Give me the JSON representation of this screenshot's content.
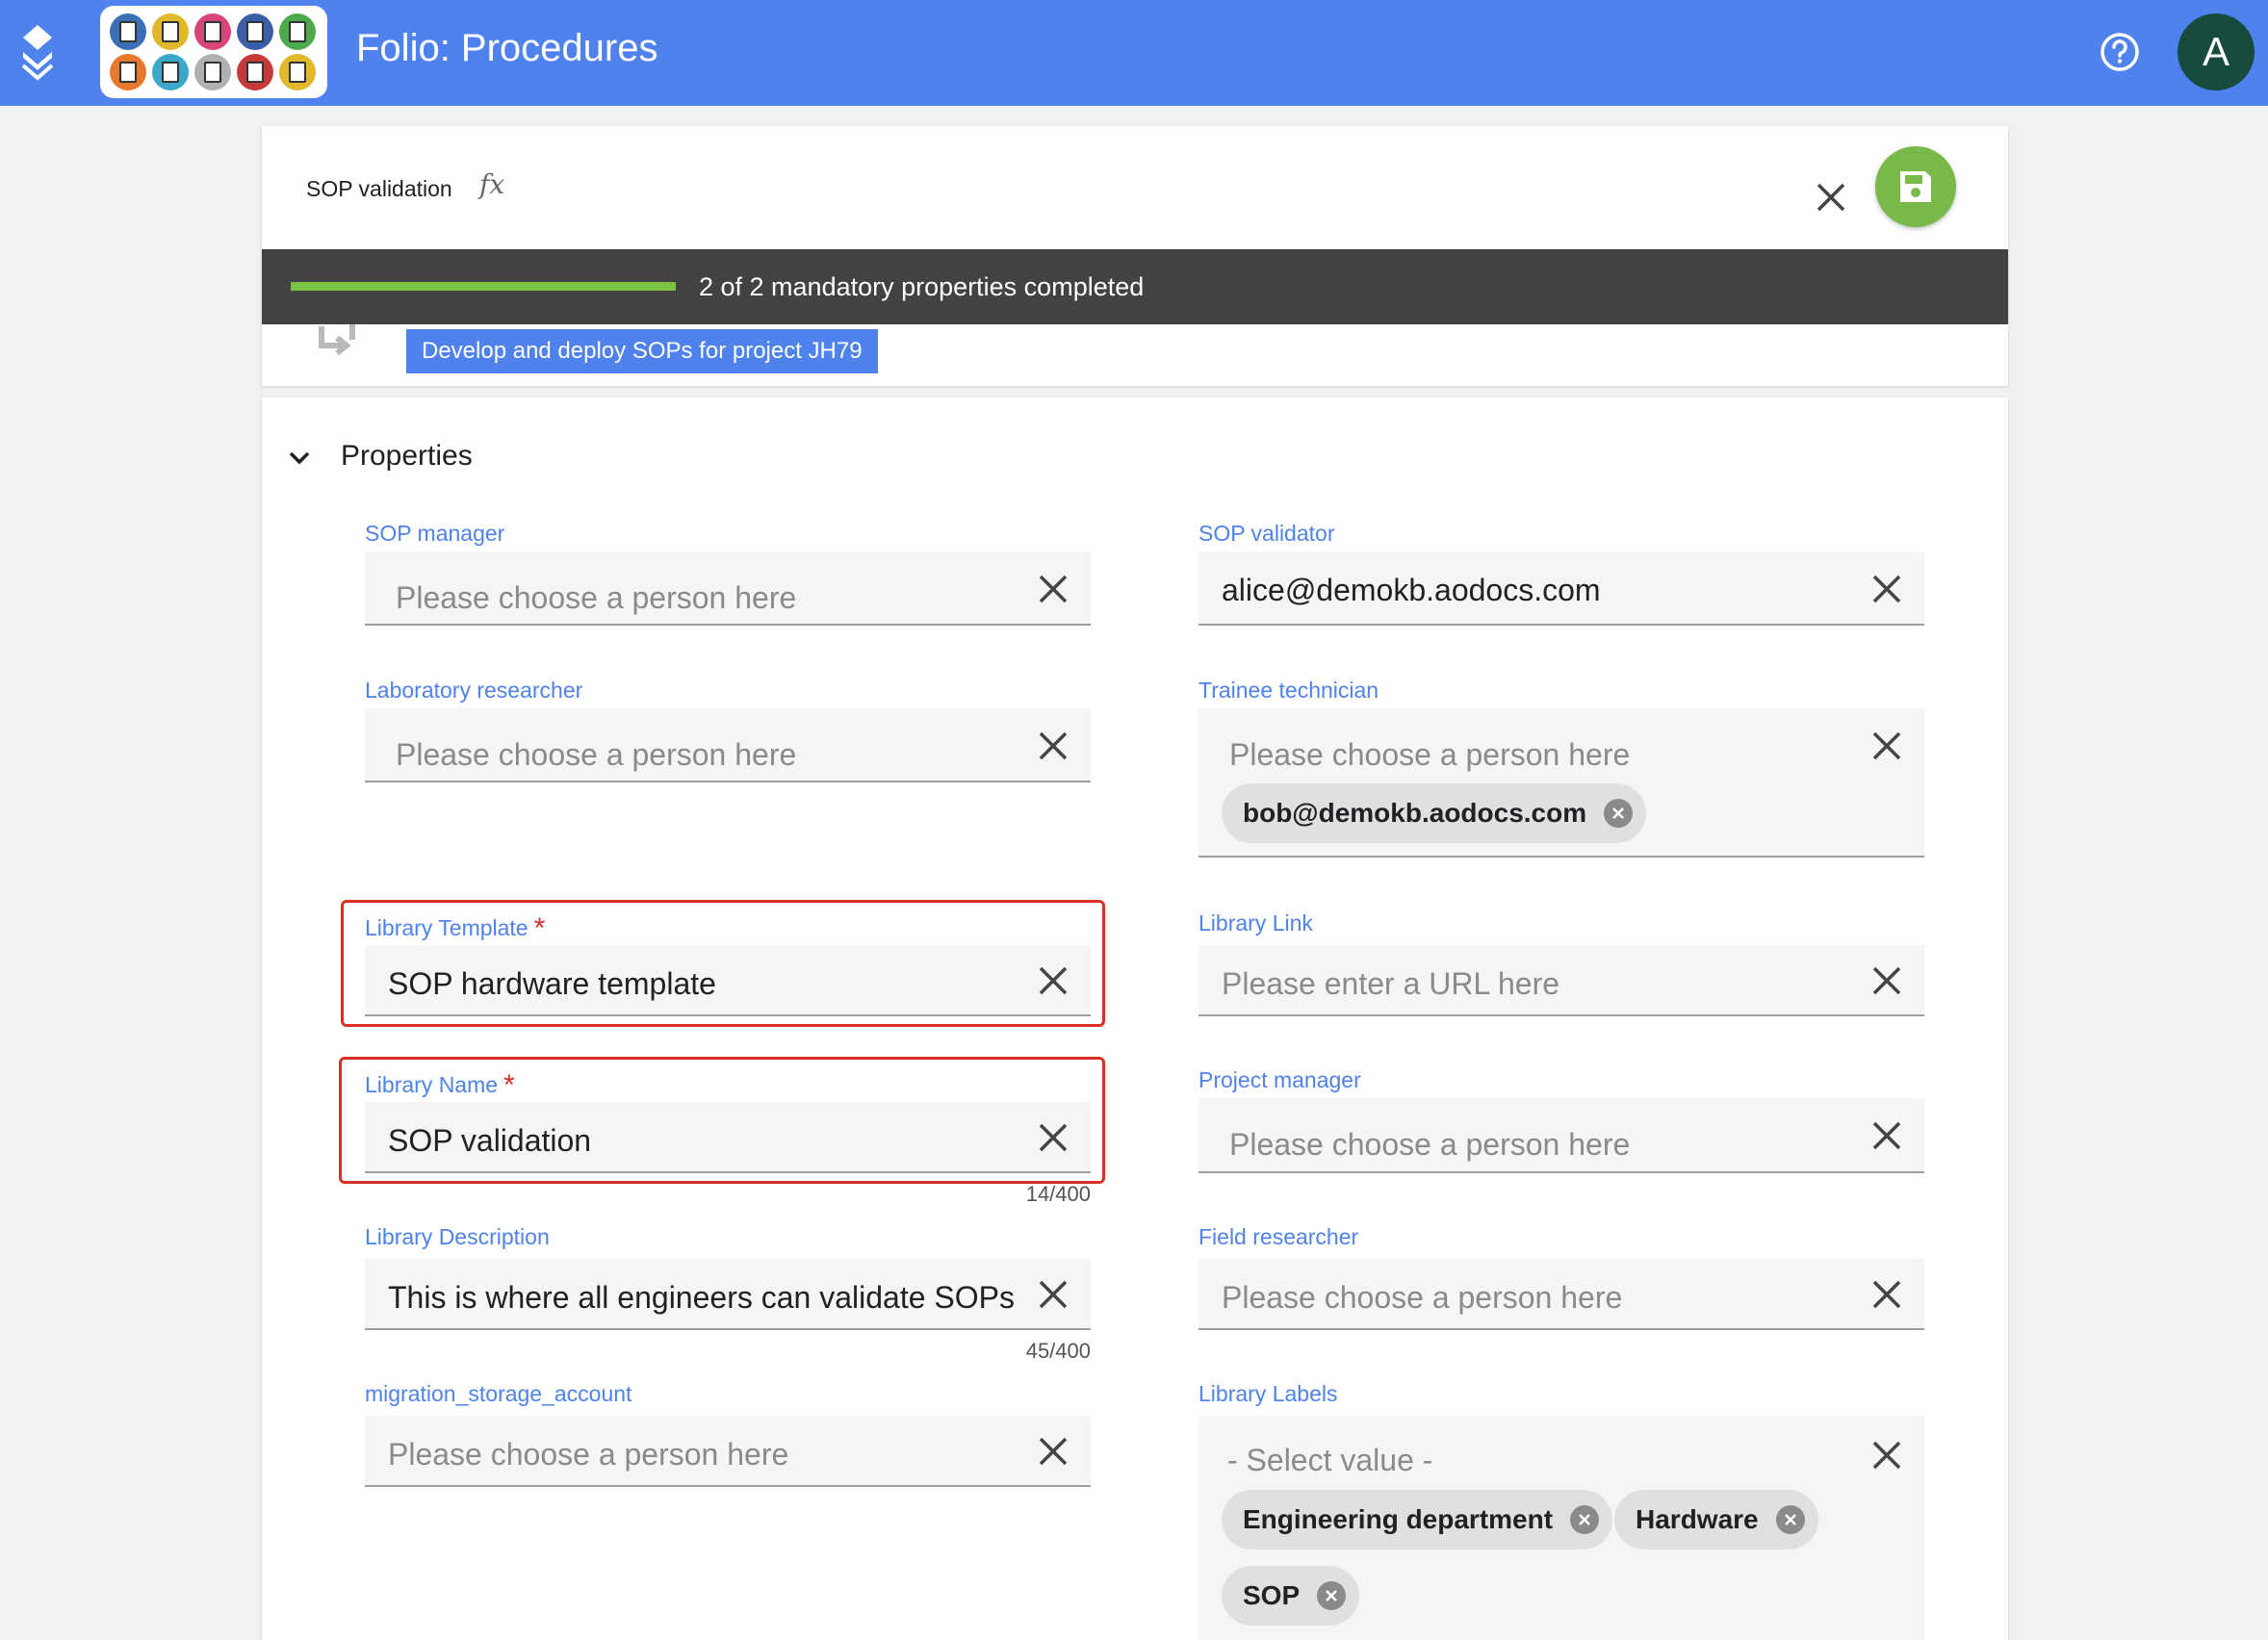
{
  "app": {
    "title": "Folio: Procedures",
    "avatar_letter": "A",
    "tile_colors": [
      "#3d6fb6",
      "#e0b82c",
      "#d8457a",
      "#3b5ea8",
      "#4caa4a",
      "#e6792d",
      "#3aa8c9",
      "#b0b0b0",
      "#c73a3a",
      "#e3b92c"
    ]
  },
  "document": {
    "title": "SOP validation",
    "fx_label": "fx",
    "progress_text": "2 of 2 mandatory properties completed",
    "progress_fraction": 1.0,
    "workflow_label": "Develop and deploy SOPs for project JH79"
  },
  "properties": {
    "section_title": "Properties",
    "sop_manager": {
      "label": "SOP manager",
      "placeholder": "Please choose a person here"
    },
    "sop_validator": {
      "label": "SOP validator",
      "value": "alice@demokb.aodocs.com"
    },
    "lab_researcher": {
      "label": "Laboratory researcher",
      "placeholder": "Please choose a person here"
    },
    "trainee_technician": {
      "label": "Trainee technician",
      "placeholder": "Please choose a person here",
      "chip": "bob@demokb.aodocs.com"
    },
    "library_template": {
      "label": "Library Template",
      "required": "*",
      "value": "SOP hardware template"
    },
    "library_link": {
      "label": "Library Link",
      "placeholder": "Please enter a URL here"
    },
    "library_name": {
      "label": "Library Name",
      "required": "*",
      "value": "SOP validation",
      "counter": "14/400"
    },
    "project_manager": {
      "label": "Project manager",
      "placeholder": "Please choose a person here"
    },
    "library_description": {
      "label": "Library Description",
      "value": "This is where all engineers can validate SOPs",
      "counter": "45/400"
    },
    "field_researcher": {
      "label": "Field researcher",
      "placeholder": "Please choose a person here"
    },
    "migration_storage_account": {
      "label": "migration_storage_account",
      "placeholder": "Please choose a person here"
    },
    "library_labels": {
      "label": "Library Labels",
      "placeholder": "- Select value -",
      "chips": [
        "Engineering department",
        "Hardware",
        "SOP"
      ]
    }
  }
}
